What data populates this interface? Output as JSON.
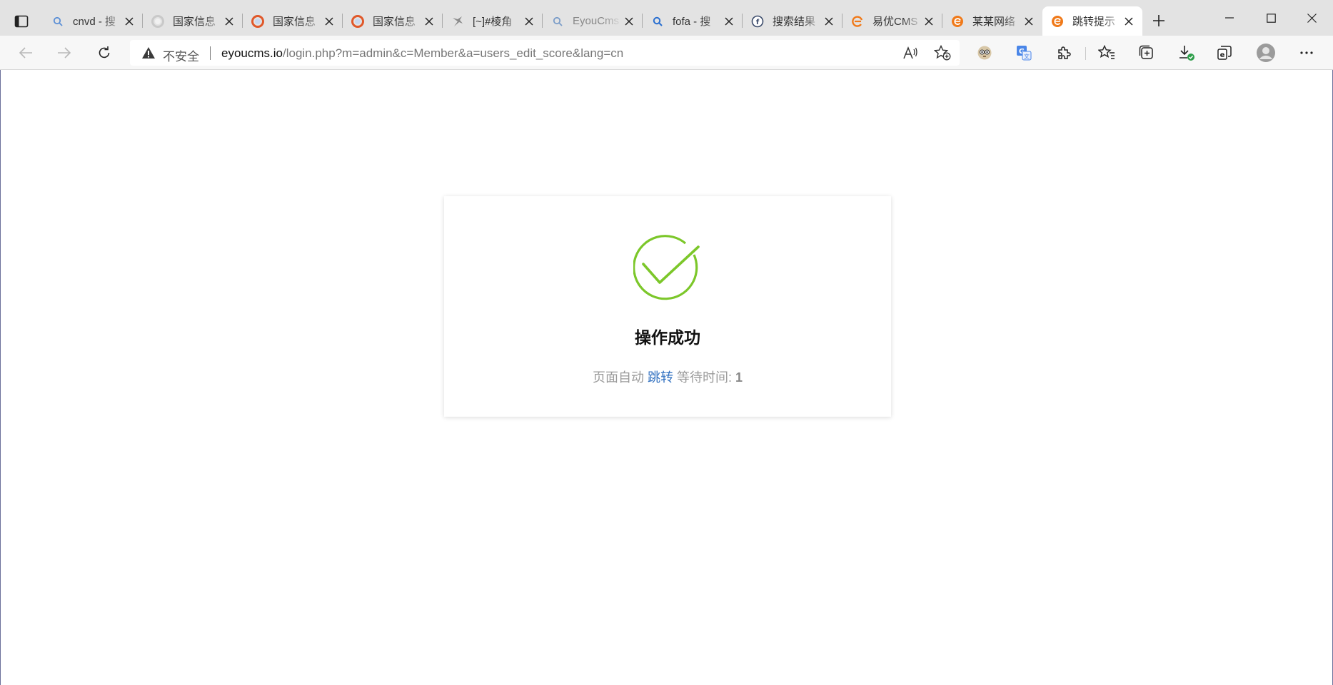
{
  "browser": {
    "tabs": [
      {
        "title": "cnvd - 搜",
        "icon": "search-icon",
        "active": false
      },
      {
        "title": "国家信息",
        "icon": "cnvd-logo-icon",
        "active": false
      },
      {
        "title": "国家信息",
        "icon": "cnvd-logo-icon",
        "active": false
      },
      {
        "title": "国家信息",
        "icon": "cnvd-logo-icon",
        "active": false
      },
      {
        "title": "[~]#棱角",
        "icon": "bird-icon",
        "active": false
      },
      {
        "title": "EyouCms",
        "icon": "search-icon",
        "active": false
      },
      {
        "title": "fofa - 搜",
        "icon": "search-icon",
        "active": false
      },
      {
        "title": "搜索结果",
        "icon": "fofa-icon",
        "active": false
      },
      {
        "title": "易优CMS",
        "icon": "eyou-logo-icon",
        "active": false
      },
      {
        "title": "某某网络",
        "icon": "eyou-logo-icon",
        "active": false
      },
      {
        "title": "跳转提示",
        "icon": "eyou-logo-icon",
        "active": true
      }
    ],
    "address": {
      "security_label": "不安全",
      "host": "eyoucms.io",
      "path": "/login.php?m=admin&c=Member&a=users_edit_score&lang=cn"
    }
  },
  "page": {
    "title": "操作成功",
    "auto_prefix": "页面自动",
    "jump_link": "跳转",
    "wait_label": "等待时间:",
    "wait_seconds": "1"
  },
  "colors": {
    "success_green": "#7cc72a",
    "link_blue": "#2f6fc0",
    "eyou_orange": "#f07a1a"
  }
}
